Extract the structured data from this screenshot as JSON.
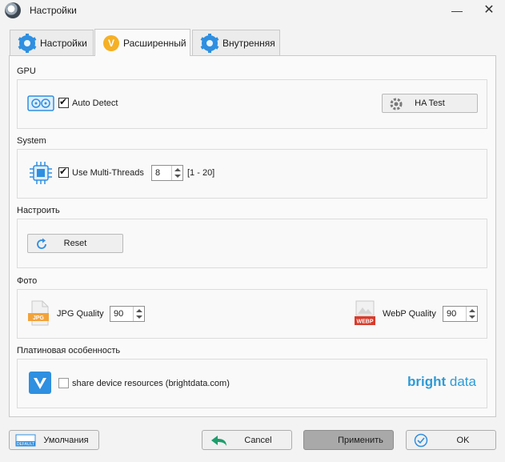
{
  "window": {
    "title": "Настройки",
    "minimize": "—",
    "close": "✕"
  },
  "tabs": [
    {
      "label": "Настройки",
      "icon": "gear-icon"
    },
    {
      "label": "Расширенный",
      "icon": "v-badge-icon",
      "badge": "V"
    },
    {
      "label": "Внутренняя",
      "icon": "gear-icon"
    }
  ],
  "gpu": {
    "title": "GPU",
    "auto_detect_label": "Auto Detect",
    "auto_detect_checked": true,
    "ha_test_label": "HA Test"
  },
  "system": {
    "title": "System",
    "multi_threads_label": "Use Multi-Threads",
    "multi_threads_checked": true,
    "threads_value": "8",
    "threads_range": "[1 - 20]"
  },
  "reset_section": {
    "title": "Настроить",
    "reset_label": "Reset"
  },
  "photo": {
    "title": "Фото",
    "jpg_icon_text": "JPG",
    "jpg_label": "JPG Quality",
    "jpg_value": "90",
    "webp_icon_text": "WEBP",
    "webp_label": "WebP Quality",
    "webp_value": "90"
  },
  "platinum": {
    "title": "Платиновая особенность",
    "share_label": "share device resources (brightdata.com)",
    "share_checked": false,
    "brand_bright": "bright",
    "brand_data": " data"
  },
  "footer": {
    "default_label": "Умолчания",
    "default_icon_text": "DEFAULT",
    "cancel_label": "Cancel",
    "apply_label": "Применить",
    "ok_label": "OK"
  },
  "colors": {
    "accent_blue": "#2f8fe0",
    "badge_orange": "#f5b025",
    "webp_red": "#d83b2b",
    "jpg_orange": "#f2a33a",
    "brightdata": "#2d9bd6"
  }
}
